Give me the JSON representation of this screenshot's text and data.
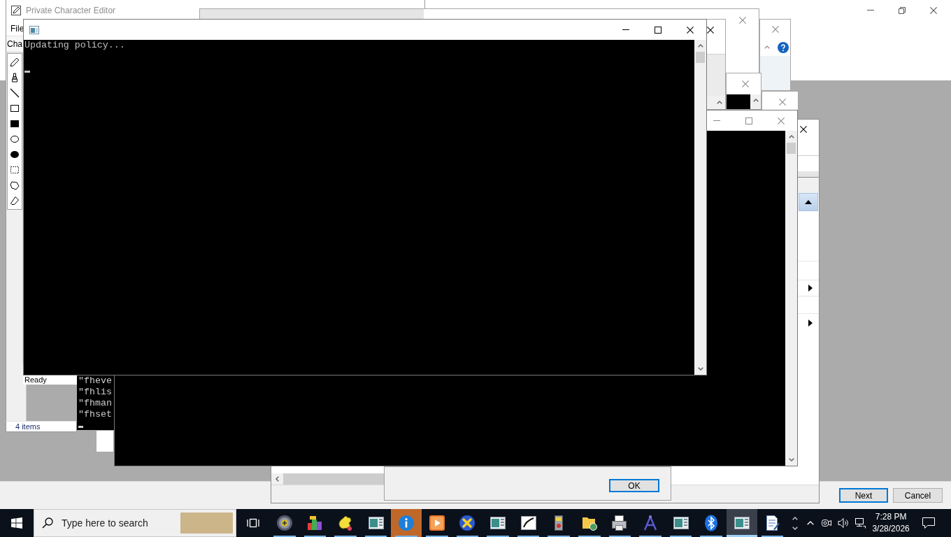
{
  "wizard": {
    "buttons": [
      {
        "label": "Next",
        "default": true
      },
      {
        "label": "Cancel",
        "default": false
      }
    ]
  },
  "char_editor": {
    "title": "Private Character Editor",
    "menu": [
      "File"
    ],
    "toolbar_label": "Cha",
    "tools": [
      {
        "kind": "pencil",
        "selected": false
      },
      {
        "kind": "brush",
        "selected": false
      },
      {
        "kind": "line",
        "selected": false
      },
      {
        "kind": "rectangle",
        "selected": false
      },
      {
        "kind": "filled_rectangle",
        "selected": false
      },
      {
        "kind": "ellipse",
        "selected": false
      },
      {
        "kind": "filled_ellipse",
        "selected": false
      },
      {
        "kind": "rectangle_select",
        "selected": false
      },
      {
        "kind": "freeform_select",
        "selected": false
      },
      {
        "kind": "eraser",
        "selected": false
      }
    ]
  },
  "document_window": {
    "status": "Ready"
  },
  "explorer": {
    "status": "4 items"
  },
  "small_console": {
    "lines": [
      "\"fheve",
      "\"fhlis",
      "\"fhman",
      "\"fhset"
    ]
  },
  "dialog": {
    "buttons": [
      {
        "label": "OK",
        "default": true
      }
    ]
  },
  "console": {
    "lines": [
      "Updating policy..."
    ]
  },
  "taskbar": {
    "search": {
      "placeholder": "Type here to search"
    },
    "apps": [
      {
        "kind": "disc",
        "selected": false,
        "flashing": false
      },
      {
        "kind": "blocks",
        "selected": false,
        "flashing": false
      },
      {
        "kind": "hand",
        "selected": false,
        "flashing": false
      },
      {
        "kind": "window",
        "selected": false,
        "flashing": false
      },
      {
        "kind": "info",
        "selected": false,
        "flashing": true
      },
      {
        "kind": "player",
        "selected": false,
        "flashing": false
      },
      {
        "kind": "cross",
        "selected": false,
        "flashing": false
      },
      {
        "kind": "window",
        "selected": false,
        "flashing": false
      },
      {
        "kind": "pen",
        "selected": false,
        "flashing": false
      },
      {
        "kind": "book",
        "selected": false,
        "flashing": false
      },
      {
        "kind": "folder",
        "selected": false,
        "flashing": false
      },
      {
        "kind": "printer",
        "selected": false,
        "flashing": false
      },
      {
        "kind": "compass",
        "selected": false,
        "flashing": false
      },
      {
        "kind": "window",
        "selected": false,
        "flashing": false
      },
      {
        "kind": "bluetooth",
        "selected": false,
        "flashing": false
      },
      {
        "kind": "window",
        "selected": true,
        "flashing": false
      },
      {
        "kind": "notepad",
        "selected": false,
        "flashing": false
      }
    ],
    "clock": {
      "time": "7:28 PM",
      "date": "3/28/2026"
    }
  }
}
